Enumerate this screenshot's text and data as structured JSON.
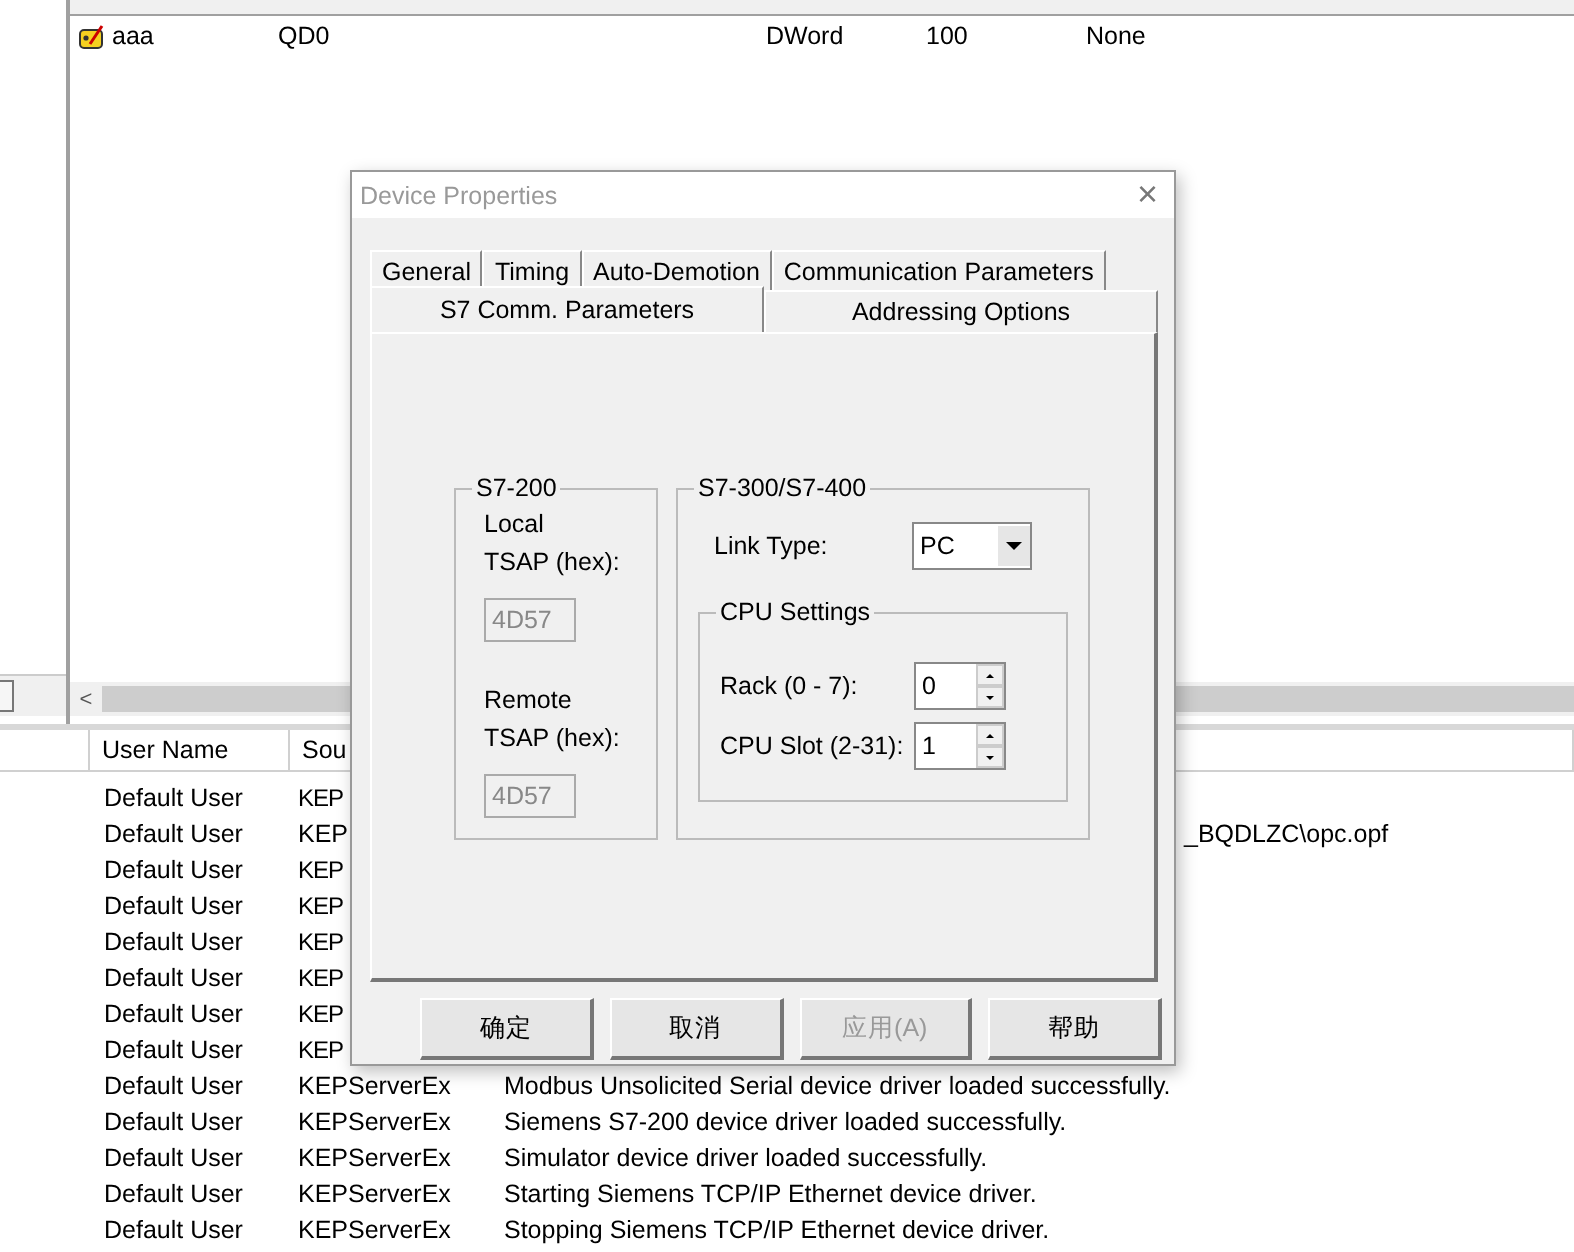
{
  "tag_table": {
    "scroll_left": "<",
    "rows": [
      {
        "name": "aaa",
        "address": "QD0",
        "data_type": "DWord",
        "scan_rate": "100",
        "scaling": "None"
      }
    ]
  },
  "event_log": {
    "columns": [
      "User Name",
      "Sou"
    ],
    "rows": [
      {
        "user": "Default User",
        "source": "KEP",
        "kind": "hidden"
      },
      {
        "user": "Default User",
        "source": "KEP",
        "message": "_BQDLZC\\opc.opf",
        "kind": "partial"
      },
      {
        "user": "Default User",
        "source": "KEP",
        "kind": "hidden"
      },
      {
        "user": "Default User",
        "source": "KEP",
        "kind": "hidden"
      },
      {
        "user": "Default User",
        "source": "KEP",
        "kind": "hidden"
      },
      {
        "user": "Default User",
        "source": "KEP",
        "kind": "hidden"
      },
      {
        "user": "Default User",
        "source": "KEP",
        "kind": "hidden"
      },
      {
        "user": "Default User",
        "source": "KEP",
        "kind": "hidden"
      },
      {
        "user": "Default User",
        "source": "KEPServerEx",
        "message": "Modbus Unsolicited Serial device driver loaded successfully.",
        "kind": "full"
      },
      {
        "user": "Default User",
        "source": "KEPServerEx",
        "message": "Siemens S7-200 device driver loaded successfully.",
        "kind": "full"
      },
      {
        "user": "Default User",
        "source": "KEPServerEx",
        "message": "Simulator device driver loaded successfully.",
        "kind": "full"
      },
      {
        "user": "Default User",
        "source": "KEPServerEx",
        "message": "Starting Siemens TCP/IP Ethernet device driver.",
        "kind": "full"
      },
      {
        "user": "Default User",
        "source": "KEPServerEx",
        "message": "Stopping Siemens TCP/IP Ethernet device driver.",
        "kind": "full"
      }
    ]
  },
  "dialog": {
    "title": "Device Properties",
    "close": "×",
    "tab_rows": [
      [
        {
          "label": "General",
          "selected": false
        },
        {
          "label": "Timing",
          "selected": false
        },
        {
          "label": "Auto-Demotion",
          "selected": false
        },
        {
          "label": "Communication Parameters",
          "selected": false
        }
      ],
      [
        {
          "label": "S7 Comm. Parameters",
          "selected": true
        },
        {
          "label": "Addressing Options",
          "selected": false
        }
      ]
    ],
    "s7_200": {
      "title": "S7-200",
      "local_label": [
        "Local",
        "TSAP (hex):"
      ],
      "local_value": "4D57",
      "local_disabled": true,
      "remote_label": [
        "Remote",
        "TSAP (hex):"
      ],
      "remote_value": "4D57",
      "remote_disabled": true
    },
    "s7_300": {
      "title": "S7-300/S7-400",
      "link_type_label": "Link Type:",
      "link_type": "PC",
      "cpu_settings": {
        "title": "CPU Settings",
        "rack_label": "Rack (0 - 7):",
        "rack": "0",
        "slot_label": "CPU Slot (2-31):",
        "slot": "1"
      }
    },
    "buttons": [
      {
        "label": "确定",
        "disabled": false
      },
      {
        "label": "取消",
        "disabled": false
      },
      {
        "label": "应用(A)",
        "disabled": true
      },
      {
        "label": "帮助",
        "disabled": false
      }
    ]
  }
}
